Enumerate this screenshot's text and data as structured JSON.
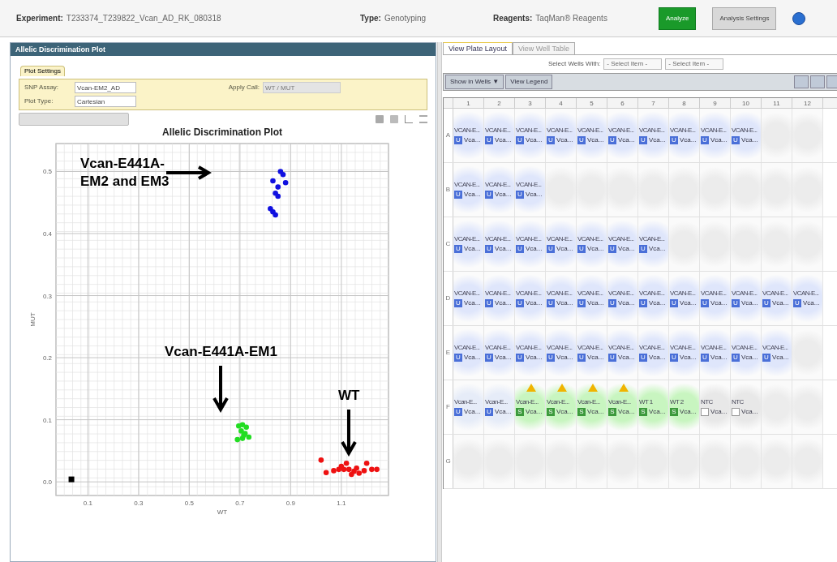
{
  "header": {
    "fields": [
      {
        "label": "Experiment:",
        "value": "T233374_T239822_Vcan_AD_RK_080318"
      },
      {
        "label": "Type:",
        "value": "Genotyping"
      },
      {
        "label": "Reagents:",
        "value": "TaqMan® Reagents"
      }
    ],
    "buttons": [
      {
        "label": "Analyze",
        "kind": "primary"
      },
      {
        "label": "Analysis Settings",
        "kind": "secondary"
      }
    ]
  },
  "left_panel": {
    "title": "Allelic Discrimination Plot",
    "settings_tab": "Plot Settings",
    "settings": [
      {
        "label": "SNP Assay:",
        "value": "Vcan-EM2_AD",
        "disabled": false
      },
      {
        "label": "Apply Call:",
        "value": "WT / MUT",
        "disabled": true
      },
      {
        "label": "Plot Type:",
        "value": "Cartesian",
        "disabled": false
      }
    ],
    "chart_data": {
      "type": "scatter",
      "grid": true,
      "title": "Allelic Discrimination Plot",
      "xlabel": "WT",
      "ylabel": "MUT",
      "xlim": [
        -0.026,
        1.286
      ],
      "ylim": [
        -0.022,
        0.545
      ],
      "xticks": [
        0.1,
        0.3,
        0.5,
        0.7,
        0.9,
        1.1
      ],
      "yticks": [
        {
          "value": 0,
          "label": "0.0"
        },
        0.1,
        0.2,
        0.3,
        0.4,
        0.5
      ],
      "series": [
        {
          "color": "#1010e0",
          "x": [
            0.86,
            0.87,
            0.83,
            0.88,
            0.85,
            0.84,
            0.85,
            0.82,
            0.83,
            0.84
          ],
          "values": [
            0.5,
            0.495,
            0.485,
            0.482,
            0.475,
            0.465,
            0.46,
            0.44,
            0.435,
            0.43
          ]
        },
        {
          "color": "#22dd22",
          "x": [
            0.695,
            0.71,
            0.725,
            0.705,
            0.72,
            0.735,
            0.69,
            0.71,
            0.715
          ],
          "values": [
            0.09,
            0.092,
            0.088,
            0.082,
            0.078,
            0.072,
            0.068,
            0.07,
            0.075
          ]
        },
        {
          "color": "#ee1111",
          "x": [
            1.02,
            1.04,
            1.07,
            1.1,
            1.12,
            1.13,
            1.15,
            1.16,
            1.24,
            1.2,
            1.22,
            1.14,
            1.17,
            1.19,
            1.11,
            1.09
          ],
          "values": [
            0.035,
            0.015,
            0.018,
            0.025,
            0.03,
            0.02,
            0.017,
            0.022,
            0.02,
            0.03,
            0.02,
            0.012,
            0.014,
            0.018,
            0.02,
            0.02
          ]
        },
        {
          "color": "#000000",
          "x": [
            0.035
          ],
          "values": [
            0.004
          ]
        }
      ],
      "annotations": [
        {
          "text": "Vcan-E441A-\nEM2 and EM3"
        },
        {
          "text": "Vcan-E441A-EM1"
        },
        {
          "text": "WT"
        }
      ]
    }
  },
  "right_panel": {
    "tabs": [
      {
        "label": "View Plate Layout",
        "selected": true
      },
      {
        "label": "View Well Table",
        "selected": false
      }
    ],
    "select_label": "Select Wells With:",
    "selects": [
      "- Select Item -",
      "- Select Item -"
    ],
    "toolbar": [
      "Show in Wells ▼",
      "View Legend"
    ],
    "columns": [
      "1",
      "2",
      "3",
      "4",
      "5",
      "6",
      "7",
      "8",
      "9",
      "10",
      "11",
      "12"
    ],
    "rows": [
      {
        "label": "A",
        "wells": [
          {
            "kind": "sample",
            "name": "VCAN-E...",
            "task": "U",
            "sample": "Vca...",
            "color": "#dfe6fb",
            "flagged": false
          },
          {
            "kind": "sample",
            "name": "VCAN-E...",
            "task": "U",
            "sample": "Vca...",
            "color": "#dfe6fb",
            "flagged": false
          },
          {
            "kind": "sample",
            "name": "VCAN-E...",
            "task": "U",
            "sample": "Vca...",
            "color": "#dfe6fb",
            "flagged": false
          },
          {
            "kind": "sample",
            "name": "VCAN-E...",
            "task": "U",
            "sample": "Vca...",
            "color": "#dfe6fb",
            "flagged": false
          },
          {
            "kind": "sample",
            "name": "VCAN-E...",
            "task": "U",
            "sample": "Vca...",
            "color": "#dfe6fb",
            "flagged": false
          },
          {
            "kind": "sample",
            "name": "VCAN-E...",
            "task": "U",
            "sample": "Vca...",
            "color": "#dfe6fb",
            "flagged": false
          },
          {
            "kind": "sample",
            "name": "VCAN-E...",
            "task": "U",
            "sample": "Vca...",
            "color": "#dfe6fb",
            "flagged": false
          },
          {
            "kind": "sample",
            "name": "VCAN-E...",
            "task": "U",
            "sample": "Vca...",
            "color": "#dfe6fb",
            "flagged": false
          },
          {
            "kind": "sample",
            "name": "VCAN-E...",
            "task": "U",
            "sample": "Vca...",
            "color": "#dfe6fb",
            "flagged": false
          },
          {
            "kind": "sample",
            "name": "VCAN-E...",
            "task": "U",
            "sample": "Vca...",
            "color": "#dfe6fb",
            "flagged": false
          },
          {
            "kind": "empty"
          },
          {
            "kind": "empty"
          }
        ]
      },
      {
        "label": "B",
        "wells": [
          {
            "kind": "sample",
            "name": "VCAN-E...",
            "task": "U",
            "sample": "Vca...",
            "color": "#dfe6fb",
            "flagged": false
          },
          {
            "kind": "sample",
            "name": "VCAN-E...",
            "task": "U",
            "sample": "Vca...",
            "color": "#dfe6fb",
            "flagged": false
          },
          {
            "kind": "sample",
            "name": "VCAN-E...",
            "task": "U",
            "sample": "Vca...",
            "color": "#dfe6fb",
            "flagged": false
          },
          {
            "kind": "empty"
          },
          {
            "kind": "empty"
          },
          {
            "kind": "empty"
          },
          {
            "kind": "empty"
          },
          {
            "kind": "empty"
          },
          {
            "kind": "empty"
          },
          {
            "kind": "empty"
          },
          {
            "kind": "empty"
          },
          {
            "kind": "empty"
          }
        ]
      },
      {
        "label": "C",
        "wells": [
          {
            "kind": "sample",
            "name": "VCAN-E...",
            "task": "U",
            "sample": "Vca...",
            "color": "#dfe6fb",
            "flagged": false
          },
          {
            "kind": "sample",
            "name": "VCAN-E...",
            "task": "U",
            "sample": "Vca...",
            "color": "#dfe6fb",
            "flagged": false
          },
          {
            "kind": "sample",
            "name": "VCAN-E...",
            "task": "U",
            "sample": "Vca...",
            "color": "#dfe6fb",
            "flagged": false
          },
          {
            "kind": "sample",
            "name": "VCAN-E...",
            "task": "U",
            "sample": "Vca...",
            "color": "#dfe6fb",
            "flagged": false
          },
          {
            "kind": "sample",
            "name": "VCAN-E...",
            "task": "U",
            "sample": "Vca...",
            "color": "#dfe6fb",
            "flagged": false
          },
          {
            "kind": "sample",
            "name": "VCAN-E...",
            "task": "U",
            "sample": "Vca...",
            "color": "#dfe6fb",
            "flagged": false
          },
          {
            "kind": "sample",
            "name": "VCAN-E...",
            "task": "U",
            "sample": "Vca...",
            "color": "#dfe6fb",
            "flagged": false
          },
          {
            "kind": "empty"
          },
          {
            "kind": "empty"
          },
          {
            "kind": "empty"
          },
          {
            "kind": "empty"
          },
          {
            "kind": "empty"
          }
        ]
      },
      {
        "label": "D",
        "wells": [
          {
            "kind": "sample",
            "name": "VCAN-E...",
            "task": "U",
            "sample": "Vca...",
            "color": "#dfe6fb",
            "flagged": false
          },
          {
            "kind": "sample",
            "name": "VCAN-E...",
            "task": "U",
            "sample": "Vca...",
            "color": "#dfe6fb",
            "flagged": false
          },
          {
            "kind": "sample",
            "name": "VCAN-E...",
            "task": "U",
            "sample": "Vca...",
            "color": "#dfe6fb",
            "flagged": false
          },
          {
            "kind": "sample",
            "name": "VCAN-E...",
            "task": "U",
            "sample": "Vca...",
            "color": "#dfe6fb",
            "flagged": false
          },
          {
            "kind": "sample",
            "name": "VCAN-E...",
            "task": "U",
            "sample": "Vca...",
            "color": "#dfe6fb",
            "flagged": false
          },
          {
            "kind": "sample",
            "name": "VCAN-E...",
            "task": "U",
            "sample": "Vca...",
            "color": "#dfe6fb",
            "flagged": false
          },
          {
            "kind": "sample",
            "name": "VCAN-E...",
            "task": "U",
            "sample": "Vca...",
            "color": "#dfe6fb",
            "flagged": false
          },
          {
            "kind": "sample",
            "name": "VCAN-E...",
            "task": "U",
            "sample": "Vca...",
            "color": "#dfe6fb",
            "flagged": false
          },
          {
            "kind": "sample",
            "name": "VCAN-E...",
            "task": "U",
            "sample": "Vca...",
            "color": "#dfe6fb",
            "flagged": false
          },
          {
            "kind": "sample",
            "name": "VCAN-E...",
            "task": "U",
            "sample": "Vca...",
            "color": "#dfe6fb",
            "flagged": false
          },
          {
            "kind": "sample",
            "name": "VCAN-E...",
            "task": "U",
            "sample": "Vca...",
            "color": "#dfe6fb",
            "flagged": false
          },
          {
            "kind": "sample",
            "name": "VCAN-E...",
            "task": "U",
            "sample": "Vca...",
            "color": "#dfe6fb",
            "flagged": false
          }
        ]
      },
      {
        "label": "E",
        "wells": [
          {
            "kind": "sample",
            "name": "VCAN-E...",
            "task": "U",
            "sample": "Vca...",
            "color": "#dfe6fb",
            "flagged": false
          },
          {
            "kind": "sample",
            "name": "VCAN-E...",
            "task": "U",
            "sample": "Vca...",
            "color": "#dfe6fb",
            "flagged": false
          },
          {
            "kind": "sample",
            "name": "VCAN-E...",
            "task": "U",
            "sample": "Vca...",
            "color": "#dfe6fb",
            "flagged": false
          },
          {
            "kind": "sample",
            "name": "VCAN-E...",
            "task": "U",
            "sample": "Vca...",
            "color": "#dfe6fb",
            "flagged": false
          },
          {
            "kind": "sample",
            "name": "VCAN-E...",
            "task": "U",
            "sample": "Vca...",
            "color": "#dfe6fb",
            "flagged": false
          },
          {
            "kind": "sample",
            "name": "VCAN-E...",
            "task": "U",
            "sample": "Vca...",
            "color": "#dfe6fb",
            "flagged": false
          },
          {
            "kind": "sample",
            "name": "VCAN-E...",
            "task": "U",
            "sample": "Vca...",
            "color": "#dfe6fb",
            "flagged": false
          },
          {
            "kind": "sample",
            "name": "VCAN-E...",
            "task": "U",
            "sample": "Vca...",
            "color": "#dfe6fb",
            "flagged": false
          },
          {
            "kind": "sample",
            "name": "VCAN-E...",
            "task": "U",
            "sample": "Vca...",
            "color": "#dfe6fb",
            "flagged": false
          },
          {
            "kind": "sample",
            "name": "VCAN-E...",
            "task": "U",
            "sample": "Vca...",
            "color": "#dfe6fb",
            "flagged": false
          },
          {
            "kind": "sample",
            "name": "VCAN-E...",
            "task": "U",
            "sample": "Vca...",
            "color": "#dfe6fb",
            "flagged": false
          },
          {
            "kind": "empty"
          }
        ]
      },
      {
        "label": "F",
        "wells": [
          {
            "kind": "sample",
            "name": "Vcan-E...",
            "task": "U",
            "sample": "Vca...",
            "color": "#e6ecf8",
            "flagged": false
          },
          {
            "kind": "sample",
            "name": "Vcan-E...",
            "task": "U",
            "sample": "Vca...",
            "color": "#e6ecf8",
            "flagged": false
          },
          {
            "kind": "sample",
            "name": "Vcan-E...",
            "task": "S",
            "sample": "Vca...",
            "color": "#c8f5c0",
            "flagged": true
          },
          {
            "kind": "sample",
            "name": "Vcan-E...",
            "task": "S",
            "sample": "Vca...",
            "color": "#c8f5c0",
            "flagged": true
          },
          {
            "kind": "sample",
            "name": "Vcan-E...",
            "task": "S",
            "sample": "Vca...",
            "color": "#c8f5c0",
            "flagged": true
          },
          {
            "kind": "sample",
            "name": "Vcan-E...",
            "task": "S",
            "sample": "Vca...",
            "color": "#c8f5c0",
            "flagged": true
          },
          {
            "kind": "sample",
            "name": "WT 1",
            "task": "S",
            "sample": "Vca...",
            "color": "#c8f5c0",
            "flagged": false
          },
          {
            "kind": "sample",
            "name": "WT 2",
            "task": "S",
            "sample": "Vca...",
            "color": "#c8f5c0",
            "flagged": false
          },
          {
            "kind": "ntc",
            "name": "NTC",
            "sample": "Vca...",
            "color": "#e8e8e8",
            "flagged": false
          },
          {
            "kind": "ntc",
            "name": "NTC",
            "sample": "Vca...",
            "color": "#e8e8e8",
            "flagged": false
          },
          {
            "kind": "empty"
          },
          {
            "kind": "empty"
          }
        ]
      },
      {
        "label": "G",
        "wells": [
          {
            "kind": "empty"
          },
          {
            "kind": "empty"
          },
          {
            "kind": "empty"
          },
          {
            "kind": "empty"
          },
          {
            "kind": "empty"
          },
          {
            "kind": "empty"
          },
          {
            "kind": "empty"
          },
          {
            "kind": "empty"
          },
          {
            "kind": "empty"
          },
          {
            "kind": "empty"
          },
          {
            "kind": "empty"
          },
          {
            "kind": "empty"
          }
        ]
      }
    ]
  }
}
